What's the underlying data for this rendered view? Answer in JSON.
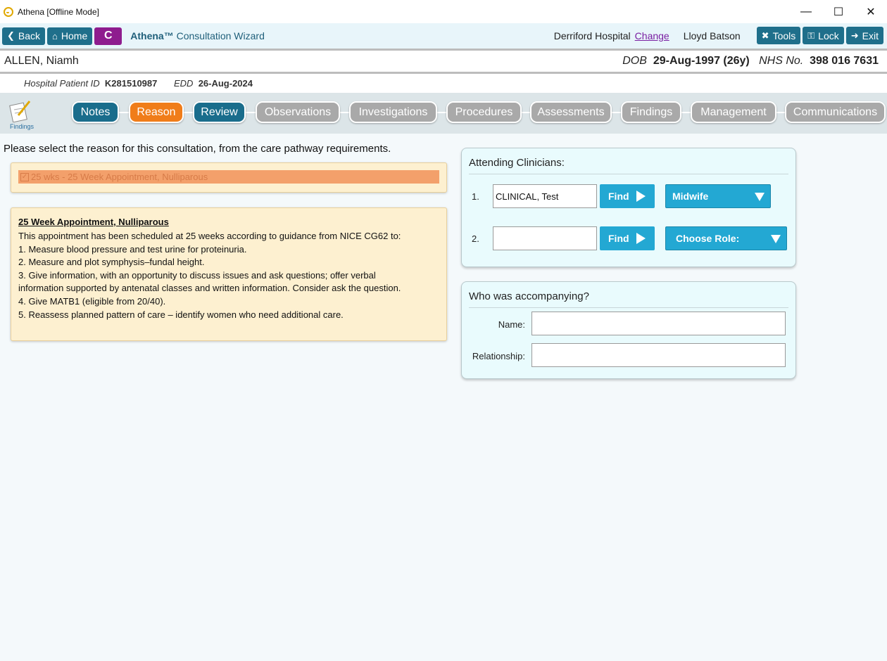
{
  "window": {
    "title": "Athena [Offline Mode]",
    "controls": [
      "minimize-icon",
      "maximize-icon",
      "close-icon"
    ]
  },
  "toolbar": {
    "back_label": "Back",
    "home_label": "Home",
    "c_label": "C",
    "app_brand": "Athena™",
    "app_title": "Consultation Wizard",
    "hospital": "Derriford Hospital",
    "change_label": "Change",
    "user": "Lloyd Batson",
    "tools_label": "Tools",
    "lock_label": "Lock",
    "exit_label": "Exit"
  },
  "patient": {
    "name": "ALLEN, Niamh",
    "dob_label": "DOB",
    "dob": "29-Aug-1997 (26y)",
    "nhs_label": "NHS No.",
    "nhs": "398 016 7631",
    "hospital_id_label": "Hospital Patient ID",
    "hospital_id": "K281510987",
    "edd_label": "EDD",
    "edd": "26-Aug-2024"
  },
  "findings_icon_label": "Findings",
  "tabs": [
    {
      "label": "Notes",
      "state": "done"
    },
    {
      "label": "Reason",
      "state": "active"
    },
    {
      "label": "Review",
      "state": "done"
    },
    {
      "label": "Observations",
      "state": "pending"
    },
    {
      "label": "Investigations",
      "state": "pending"
    },
    {
      "label": "Procedures",
      "state": "pending"
    },
    {
      "label": "Assessments",
      "state": "pending"
    },
    {
      "label": "Findings",
      "state": "pending"
    },
    {
      "label": "Management",
      "state": "pending"
    },
    {
      "label": "Communications",
      "state": "pending"
    }
  ],
  "reason": {
    "prompt": "Please select the reason for this consultation, from the care pathway requirements.",
    "selected_item": "25 wks - 25 Week Appointment, Nulliparous",
    "description": {
      "title": "25 Week Appointment, Nulliparous",
      "lines": [
        "This appointment has been scheduled at 25 weeks according to guidance from NICE CG62 to:",
        "1. Measure blood pressure and test urine for proteinuria.",
        "2. Measure and plot symphysis–fundal height.",
        "3. Give information, with an opportunity to discuss issues and ask questions; offer verbal",
        "information supported by antenatal classes and written information. Consider ask the question.",
        "4. Give MATB1 (eligible from 20/40).",
        "5. Reassess planned pattern of care – identify women who need additional care."
      ]
    }
  },
  "clinicians": {
    "title": "Attending Clinicians:",
    "rows": [
      {
        "num": "1.",
        "value": "CLINICAL, Test",
        "find_label": "Find",
        "role": "Midwife"
      },
      {
        "num": "2.",
        "value": "",
        "find_label": "Find",
        "role": "Choose Role:"
      }
    ]
  },
  "accompanying": {
    "title": "Who was accompanying?",
    "name_label": "Name:",
    "name_value": "",
    "relationship_label": "Relationship:",
    "relationship_value": ""
  }
}
